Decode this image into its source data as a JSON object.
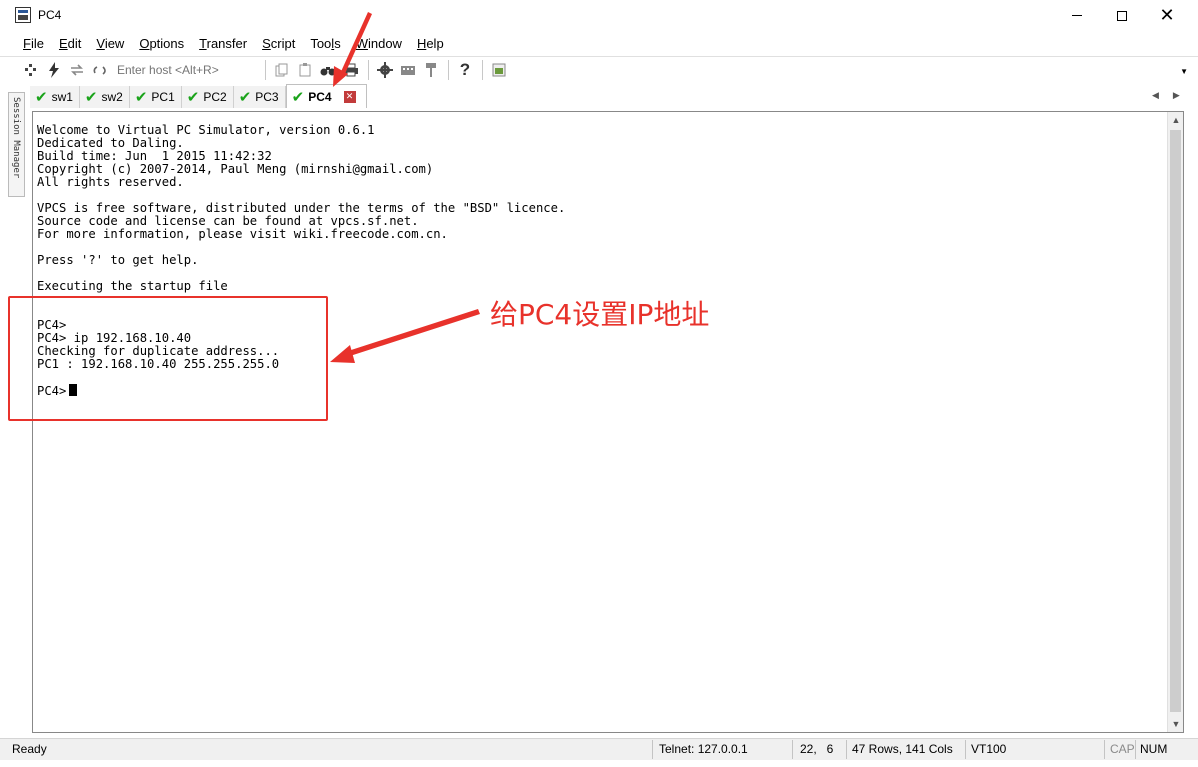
{
  "window": {
    "title": "PC4"
  },
  "menu": [
    "File",
    "Edit",
    "View",
    "Options",
    "Transfer",
    "Script",
    "Tools",
    "Window",
    "Help"
  ],
  "menu_underline": [
    "F",
    "E",
    "V",
    "O",
    "T",
    "S",
    "l",
    "W",
    "H"
  ],
  "toolbar": {
    "host_placeholder": "Enter host <Alt+R>"
  },
  "tabs": [
    {
      "label": "sw1"
    },
    {
      "label": "sw2"
    },
    {
      "label": "PC1"
    },
    {
      "label": "PC2"
    },
    {
      "label": "PC3"
    },
    {
      "label": "PC4",
      "active": true
    }
  ],
  "session_manager_label": "Session Manager",
  "terminal": {
    "lines": [
      "Welcome to Virtual PC Simulator, version 0.6.1",
      "Dedicated to Daling.",
      "Build time: Jun  1 2015 11:42:32",
      "Copyright (c) 2007-2014, Paul Meng (mirnshi@gmail.com)",
      "All rights reserved.",
      "",
      "VPCS is free software, distributed under the terms of the \"BSD\" licence.",
      "Source code and license can be found at vpcs.sf.net.",
      "For more information, please visit wiki.freecode.com.cn.",
      "",
      "Press '?' to get help.",
      "",
      "Executing the startup file",
      "",
      "",
      "PC4>",
      "PC4> ip 192.168.10.40",
      "Checking for duplicate address...",
      "PC1 : 192.168.10.40 255.255.255.0",
      ""
    ],
    "prompt": "PC4>"
  },
  "annotation": {
    "text": "给PC4设置IP地址",
    "color": "#e8322b"
  },
  "status": {
    "ready": "Ready",
    "connection": "Telnet: 127.0.0.1",
    "cursor_pos": "22,   6",
    "size": "47 Rows, 141 Cols",
    "emulation": "VT100",
    "cap": "CAP",
    "num": "NUM"
  }
}
